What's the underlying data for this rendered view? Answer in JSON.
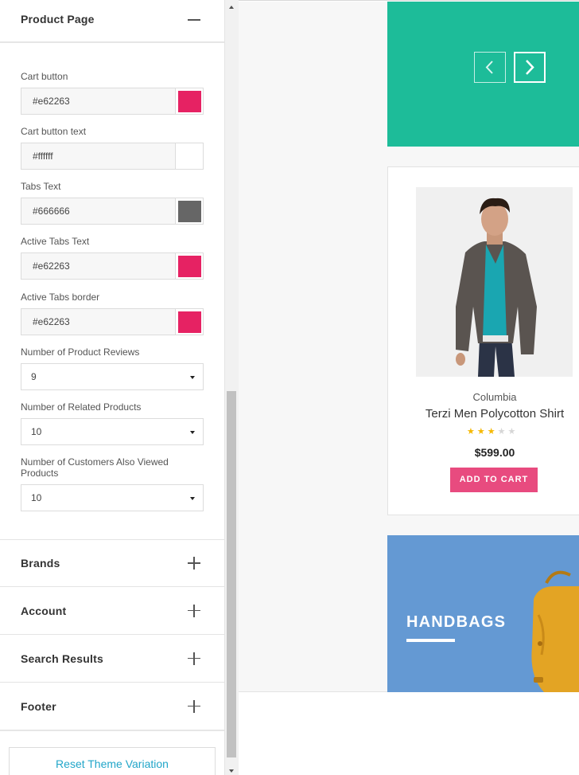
{
  "panel": {
    "top_section": {
      "title": "Product Page",
      "toggle": "minus-icon"
    },
    "color_fields": [
      {
        "label": "Cart button",
        "value": "#e62263",
        "swatch": "#e62263"
      },
      {
        "label": "Cart button text",
        "value": "#ffffff",
        "swatch": "#ffffff"
      },
      {
        "label": "Tabs Text",
        "value": "#666666",
        "swatch": "#666666"
      },
      {
        "label": "Active Tabs Text",
        "value": "#e62263",
        "swatch": "#e62263"
      },
      {
        "label": "Active Tabs border",
        "value": "#e62263",
        "swatch": "#e62263"
      }
    ],
    "selects": [
      {
        "label": "Number of Product Reviews",
        "value": "9"
      },
      {
        "label": "Number of Related Products",
        "value": "10"
      },
      {
        "label": "Number of Customers Also Viewed Products",
        "value": "10"
      }
    ],
    "sections": [
      {
        "title": "Brands",
        "toggle": "plus-icon"
      },
      {
        "title": "Account",
        "toggle": "plus-icon"
      },
      {
        "title": "Search Results",
        "toggle": "plus-icon"
      },
      {
        "title": "Footer",
        "toggle": "plus-icon"
      }
    ],
    "reset_label": "Reset Theme Variation"
  },
  "preview": {
    "slider": {
      "color": "#1dbc99",
      "prev_icon": "chevron-left-icon",
      "next_icon": "chevron-right-icon"
    },
    "product": {
      "brand": "Columbia",
      "name": "Terzi Men Polycotton Shirt",
      "rating": 3,
      "rating_max": 5,
      "price": "$599.00",
      "cart_label": "ADD TO CART",
      "cart_color": "#e84b7f"
    },
    "banner": {
      "title": "HANDBAGS",
      "color": "#6499d3"
    }
  }
}
